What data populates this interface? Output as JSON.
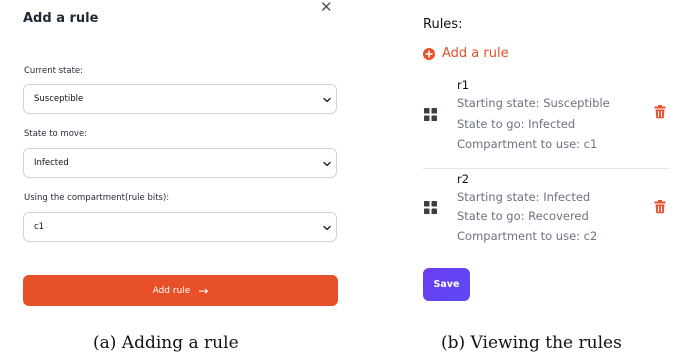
{
  "add_rule_form": {
    "title": "Add a rule",
    "close_icon": "close-icon",
    "current_state": {
      "label": "Current state:",
      "value": "Susceptible"
    },
    "state_to_move": {
      "label": "State to move:",
      "value": "Infected"
    },
    "compartment": {
      "label": "Using the compartment(rule bits):",
      "value": "c1"
    },
    "submit": {
      "label": "Add rule",
      "icon": "arrow-right-icon"
    },
    "accent_color": "#e8502a"
  },
  "rules_panel": {
    "heading": "Rules:",
    "add_link": {
      "label": "Add a rule",
      "icon": "plus-circle-icon"
    },
    "rules": [
      {
        "name": "r1",
        "starting_state": "Starting state: Susceptible",
        "state_to_go": "State to go: Infected",
        "compartment": "Compartment to use: c1",
        "drag_icon": "grid-icon",
        "delete_icon": "trash-icon"
      },
      {
        "name": "r2",
        "starting_state": "Starting state: Infected",
        "state_to_go": "State to go: Recovered",
        "compartment": "Compartment to use: c2",
        "drag_icon": "grid-icon",
        "delete_icon": "trash-icon"
      }
    ],
    "save_label": "Save",
    "save_color": "#6d3bf0",
    "delete_color": "#e8502a"
  },
  "captions": {
    "a": "(a) Adding a rule",
    "b": "(b) Viewing the rules"
  }
}
